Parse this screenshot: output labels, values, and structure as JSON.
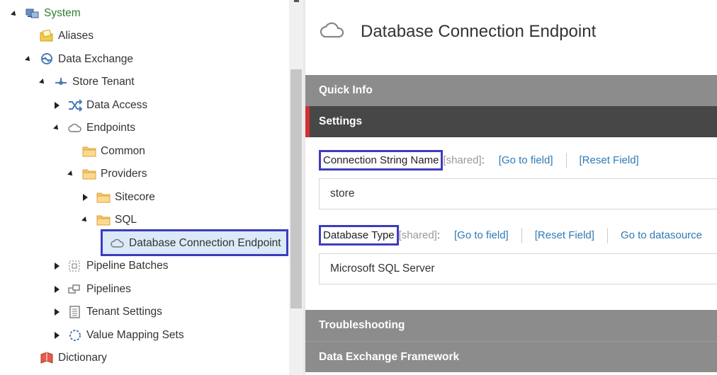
{
  "tree": {
    "system": "System",
    "aliases": "Aliases",
    "data_exchange": "Data Exchange",
    "store_tenant": "Store Tenant",
    "data_access": "Data Access",
    "endpoints": "Endpoints",
    "common": "Common",
    "providers": "Providers",
    "sitecore": "Sitecore",
    "sql": "SQL",
    "db_conn_endpoint": "Database Connection Endpoint",
    "pipeline_batches": "Pipeline Batches",
    "pipelines": "Pipelines",
    "tenant_settings": "Tenant Settings",
    "value_mapping_sets": "Value Mapping Sets",
    "dictionary": "Dictionary"
  },
  "editor": {
    "title": "Database Connection Endpoint",
    "sections": {
      "quick_info": "Quick Info",
      "settings": "Settings",
      "troubleshooting": "Troubleshooting",
      "dxf": "Data Exchange Framework"
    },
    "fields": {
      "conn_string": {
        "label": "Connection String Name",
        "shared": "[shared]",
        "colon": ":",
        "goto": "[Go to field]",
        "reset": "[Reset Field]",
        "value": "store"
      },
      "db_type": {
        "label": "Database Type",
        "shared": "[shared]",
        "colon": ":",
        "goto": "[Go to field]",
        "reset": "[Reset Field]",
        "datasource": "Go to datasource",
        "value": "Microsoft SQL Server"
      }
    }
  },
  "colors": {
    "selection_border": "#3c3cc0",
    "section_grey": "#8c8c8c",
    "section_active": "#474747",
    "active_marker": "#d32f2f",
    "link": "#2f7ab5",
    "system_label": "#2e7d32"
  }
}
